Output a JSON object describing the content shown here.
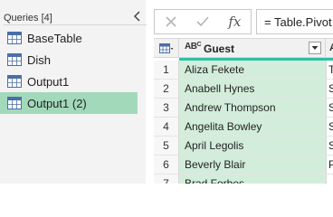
{
  "queries": {
    "header": "Queries [4]",
    "items": [
      {
        "label": "BaseTable",
        "icon": "table-icon",
        "selected": false
      },
      {
        "label": "Dish",
        "icon": "table-icon",
        "selected": false
      },
      {
        "label": "Output1",
        "icon": "table-icon",
        "selected": false
      },
      {
        "label": "Output1 (2)",
        "icon": "table-icon",
        "selected": true
      }
    ]
  },
  "formula_bar": {
    "cancel_icon": "close-icon",
    "confirm_icon": "check-icon",
    "fx_label": "fx",
    "formula": "= Table.Pivot"
  },
  "grid": {
    "column_type_label": "ABC",
    "column_header": "Guest",
    "next_column_header_fragment": "A",
    "rows": [
      {
        "num": "1",
        "guest": "Aliza Fekete",
        "next": "T"
      },
      {
        "num": "2",
        "guest": "Anabell Hynes",
        "next": "S"
      },
      {
        "num": "3",
        "guest": "Andrew Thompson",
        "next": "S"
      },
      {
        "num": "4",
        "guest": "Angelita Bowley",
        "next": "S"
      },
      {
        "num": "5",
        "guest": "April Legolis",
        "next": "S"
      },
      {
        "num": "6",
        "guest": "Beverly Blair",
        "next": "P"
      },
      {
        "num": "7",
        "guest": "Brad Forbes",
        "next": ""
      }
    ]
  },
  "colors": {
    "selected_query_bg": "#a3d9bb",
    "selected_column_bg": "#d3eddb",
    "quality_bar": "#2ec1a3"
  }
}
